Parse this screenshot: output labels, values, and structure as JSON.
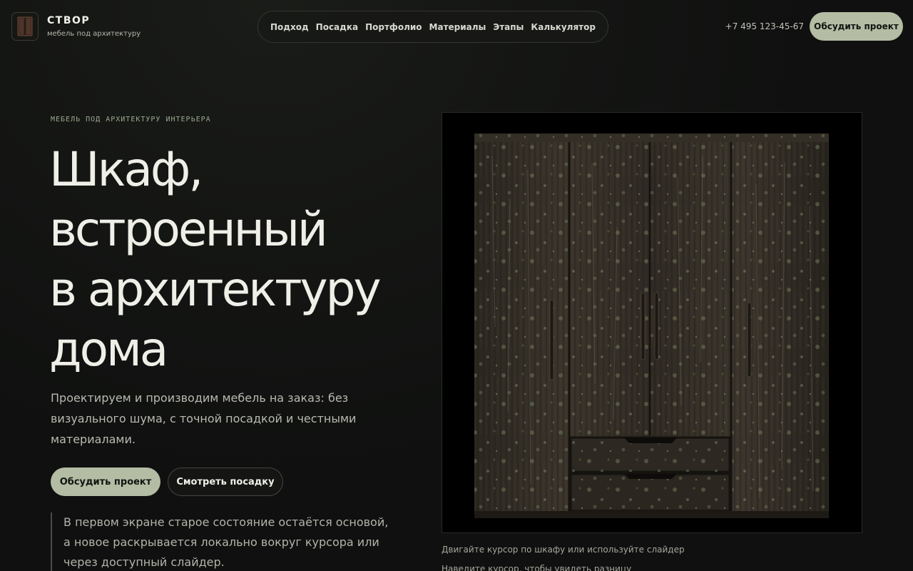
{
  "brand": {
    "name": "СТВОР",
    "tagline": "мебель под архитектуру"
  },
  "nav": [
    {
      "label": "Подход"
    },
    {
      "label": "Посадка"
    },
    {
      "label": "Портфолио"
    },
    {
      "label": "Материалы"
    },
    {
      "label": "Этапы"
    },
    {
      "label": "Калькулятор"
    }
  ],
  "header": {
    "phone": "+7 495 123-45-67",
    "cta_label": "Обсудить проект"
  },
  "hero": {
    "eyebrow": "МЕБЕЛЬ ПОД АРХИТЕКТУРУ ИНТЕРЬЕРА",
    "title_lines": [
      "Шкаф,",
      "встроенный",
      "в архитектуру",
      "дома"
    ],
    "subtitle": "Проектируем и производим мебель на заказ: без визуального шума, с точной посадкой и честными материалами.",
    "primary_button": "Обсудить проект",
    "secondary_button": "Смотреть посадку",
    "note": "В первом экране старое состояние остаётся основой, а новое раскрывается локально вокруг курсора или через доступный слайдер."
  },
  "visual": {
    "hint_primary": "Двигайте курсор по шкафу или используйте слайдер",
    "hint_secondary": "Наведите курсор, чтобы увидеть разницу"
  },
  "colors": {
    "background": "#0f100f",
    "accent": "#b4bca4",
    "text": "#efefe8",
    "muted": "#b9bab1"
  }
}
